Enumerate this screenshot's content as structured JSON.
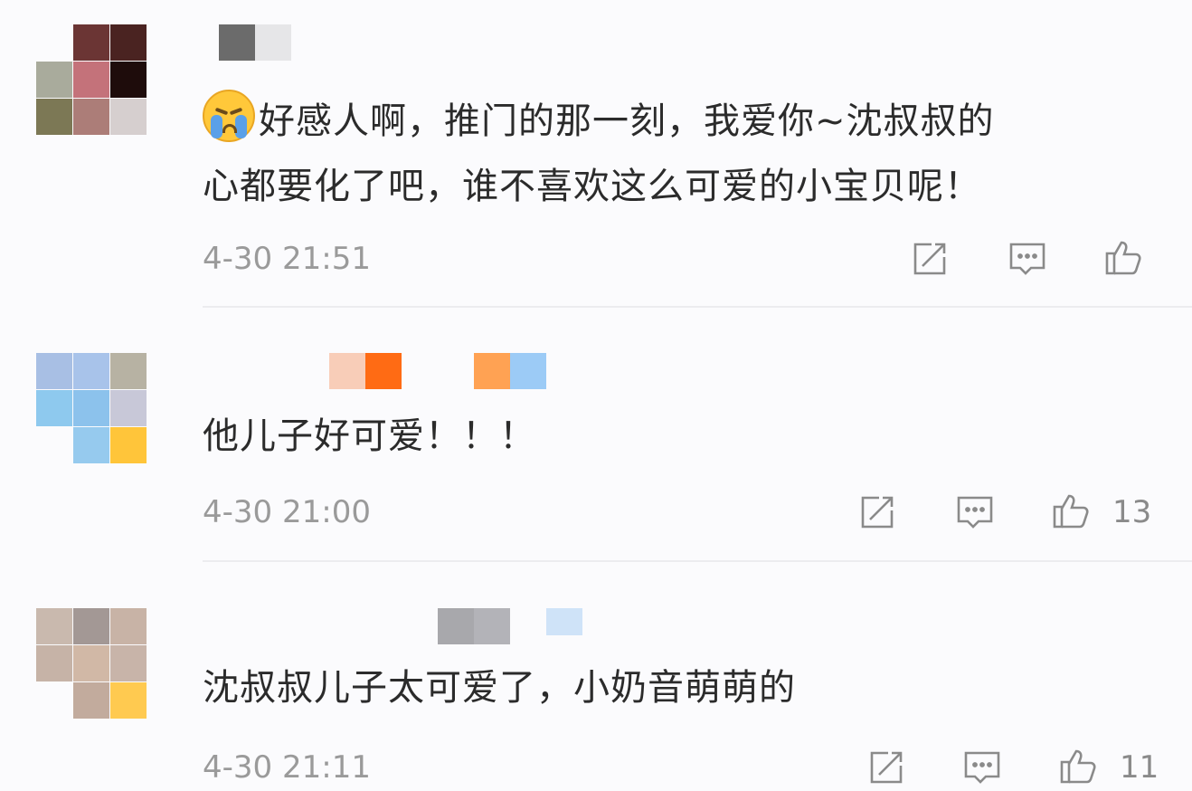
{
  "comments": [
    {
      "text": "好感人啊，推门的那一刻，我爱你~沈叔叔的",
      "text_line2": "心都要化了吧，谁不喜欢这么可爱的小宝贝呢！",
      "emoji": "crying-face-icon",
      "time": "4-30 21:51",
      "like_count": ""
    },
    {
      "text": "他儿子好可爱！！！",
      "time": "4-30 21:00",
      "like_count": "13"
    },
    {
      "text": "沈叔叔儿子太可爱了，小奶音萌萌的",
      "time": "4-30 21:11",
      "like_count": "11"
    }
  ],
  "icons": {
    "share": "share-icon",
    "reply": "reply-icon",
    "like": "thumbs-up-icon"
  },
  "colors": {
    "text": "#2b2b2b",
    "meta": "#9a9a9a",
    "icon": "#8a8a8a",
    "background": "#fbfbfd"
  }
}
